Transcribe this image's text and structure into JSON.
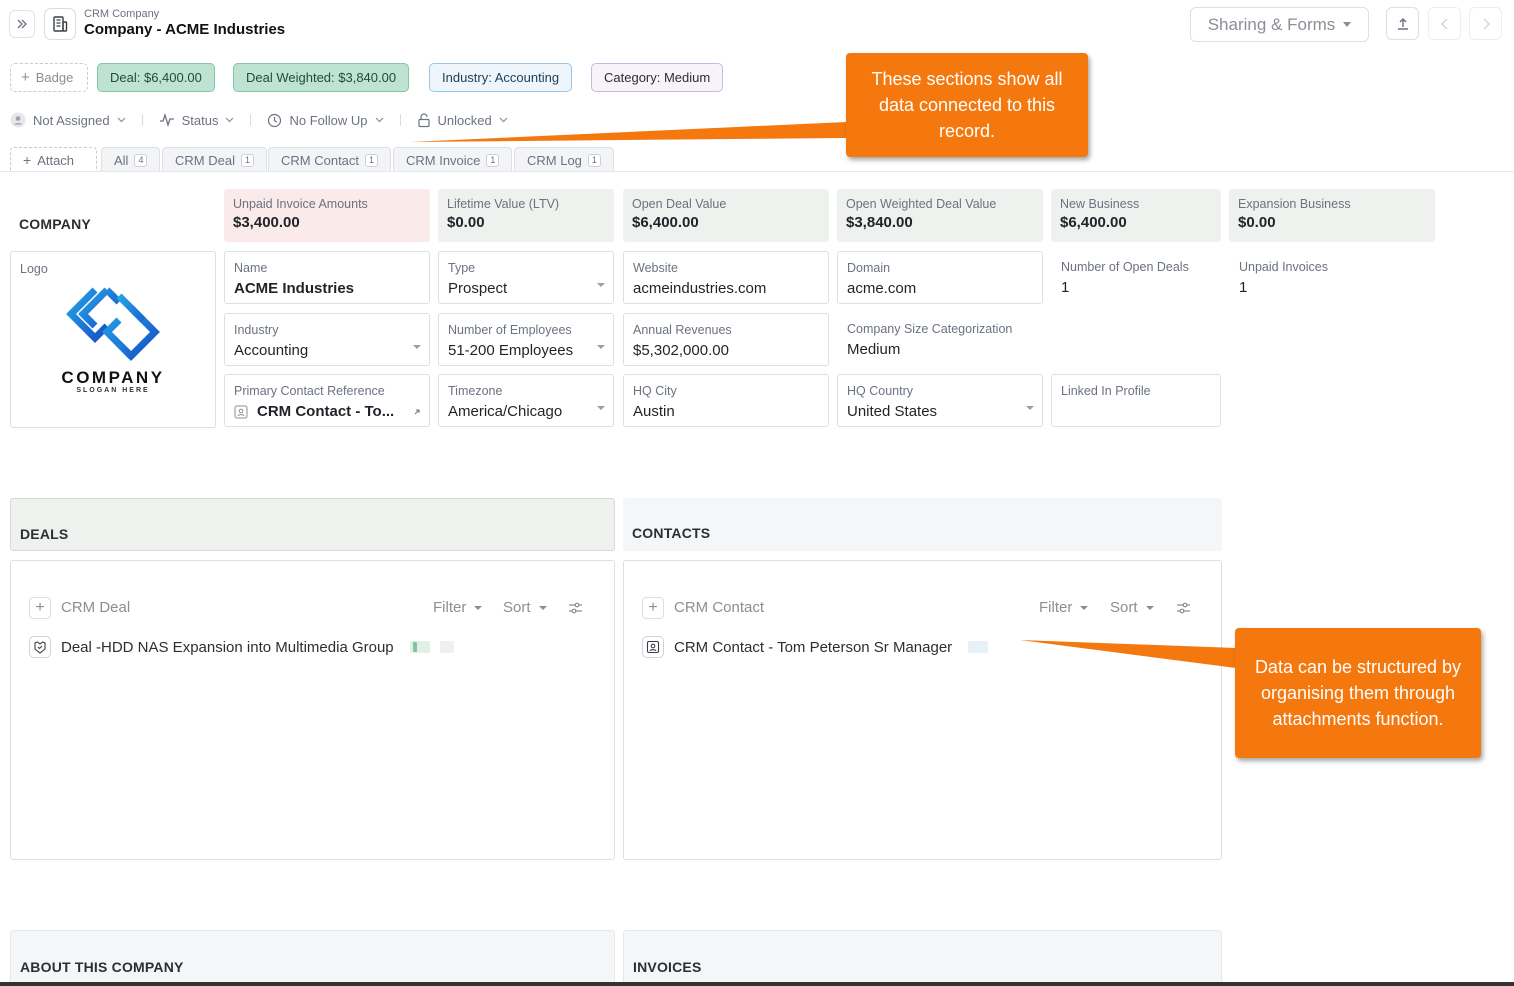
{
  "header": {
    "breadcrumb": "CRM Company",
    "title": "Company - ACME Industries",
    "sharing_label": "Sharing & Forms"
  },
  "badges": {
    "add_label": "Badge",
    "deal": "Deal: $6,400.00",
    "deal_weighted": "Deal Weighted: $3,840.00",
    "industry": "Industry: Accounting",
    "category": "Category: Medium"
  },
  "statusbar": {
    "assignee": "Not Assigned",
    "status": "Status",
    "follow_up": "No Follow Up",
    "lock": "Unlocked"
  },
  "tabs": {
    "attach": "Attach",
    "items": [
      {
        "label": "All",
        "count": "4"
      },
      {
        "label": "CRM Deal",
        "count": "1"
      },
      {
        "label": "CRM Contact",
        "count": "1"
      },
      {
        "label": "CRM Invoice",
        "count": "1"
      },
      {
        "label": "CRM Log",
        "count": "1"
      }
    ]
  },
  "company": {
    "heading": "COMPANY",
    "kpis": [
      {
        "label": "Unpaid Invoice Amounts",
        "value": "$3,400.00"
      },
      {
        "label": "Lifetime Value (LTV)",
        "value": "$0.00"
      },
      {
        "label": "Open Deal Value",
        "value": "$6,400.00"
      },
      {
        "label": "Open Weighted Deal Value",
        "value": "$3,840.00"
      },
      {
        "label": "New Business",
        "value": "$6,400.00"
      },
      {
        "label": "Expansion Business",
        "value": "$0.00"
      }
    ],
    "logo_label": "Logo",
    "logo_text": "COMPANY",
    "logo_slogan": "SLOGAN HERE",
    "fields": {
      "name": {
        "label": "Name",
        "value": "ACME Industries"
      },
      "type": {
        "label": "Type",
        "value": "Prospect"
      },
      "website": {
        "label": "Website",
        "value": "acmeindustries.com"
      },
      "domain": {
        "label": "Domain",
        "value": "acme.com"
      },
      "open_deals": {
        "label": "Number of Open Deals",
        "value": "1"
      },
      "unpaid_invoices": {
        "label": "Unpaid Invoices",
        "value": "1"
      },
      "industry": {
        "label": "Industry",
        "value": "Accounting"
      },
      "employees": {
        "label": "Number of Employees",
        "value": "51-200 Employees"
      },
      "revenues": {
        "label": "Annual Revenues",
        "value": "$5,302,000.00"
      },
      "size_cat": {
        "label": "Company Size Categorization",
        "value": "Medium"
      },
      "primary_contact": {
        "label": "Primary Contact Reference",
        "value": "CRM Contact - To..."
      },
      "timezone": {
        "label": "Timezone",
        "value": "America/Chicago"
      },
      "hq_city": {
        "label": "HQ City",
        "value": "Austin"
      },
      "hq_country": {
        "label": "HQ Country",
        "value": "United States"
      },
      "linkedin": {
        "label": "Linked In Profile",
        "value": ""
      }
    }
  },
  "deals": {
    "heading": "DEALS",
    "type_label": "CRM Deal",
    "filter": "Filter",
    "sort": "Sort",
    "row": "Deal -HDD NAS Expansion into Multimedia Group"
  },
  "contacts": {
    "heading": "CONTACTS",
    "type_label": "CRM Contact",
    "filter": "Filter",
    "sort": "Sort",
    "row": "CRM Contact - Tom Peterson Sr Manager"
  },
  "about": {
    "heading": "ABOUT THIS COMPANY"
  },
  "invoices": {
    "heading": "INVOICES"
  },
  "callouts": {
    "top": "These sections show all data connected to this record.",
    "right": "Data can be structured by organising them through attachments function."
  },
  "colors": {
    "callout": "#f5780f",
    "badge_green": "#bfe3d3",
    "kpi_red": "#fbeaea",
    "kpi_grey": "#eef1ee",
    "logo_blue": "#1e73d8"
  }
}
